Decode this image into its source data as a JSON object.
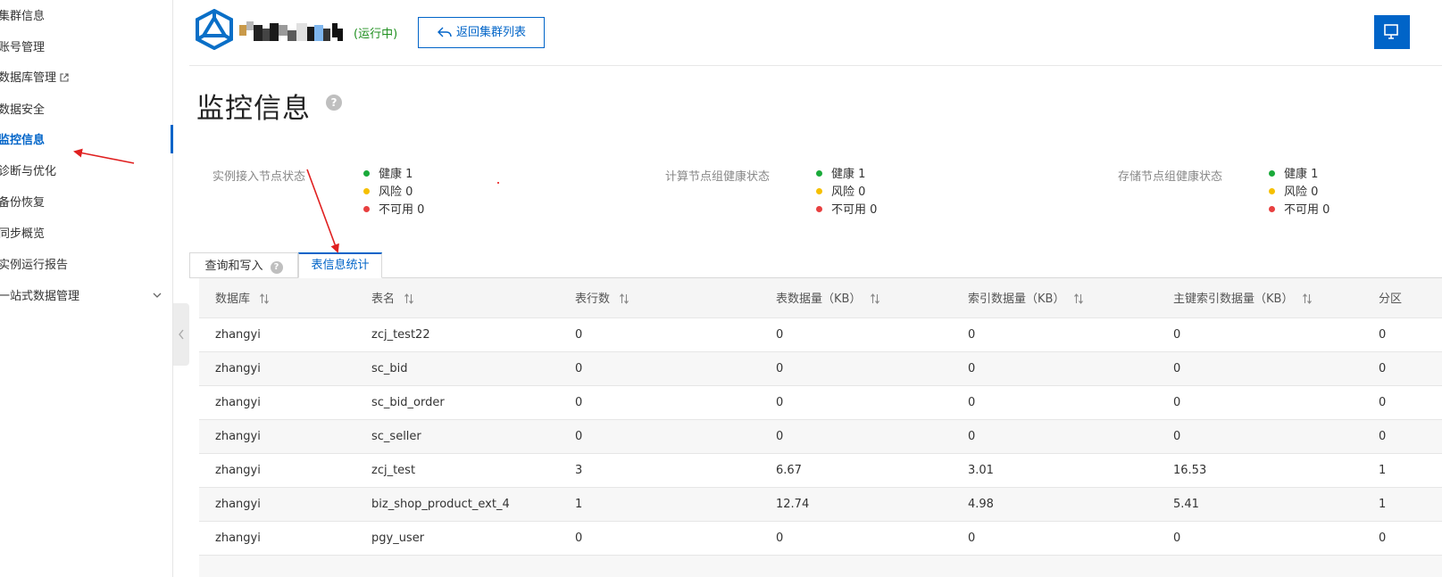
{
  "sidebar": {
    "items": [
      {
        "label": "集群信息"
      },
      {
        "label": "账号管理"
      },
      {
        "label": "数据库管理"
      },
      {
        "label": "数据安全"
      },
      {
        "label": "监控信息"
      },
      {
        "label": "诊断与优化"
      },
      {
        "label": "备份恢复"
      },
      {
        "label": "同步概览"
      },
      {
        "label": "实例运行报告"
      },
      {
        "label": "一站式数据管理"
      }
    ],
    "active_index": 4
  },
  "header": {
    "status": "(运行中)",
    "back_label": "返回集群列表"
  },
  "page": {
    "title": "监控信息",
    "help": "?"
  },
  "status_groups": [
    {
      "label": "实例接入节点状态",
      "items": [
        {
          "text": "健康 1",
          "color": "green"
        },
        {
          "text": "风险 0",
          "color": "yellow"
        },
        {
          "text": "不可用 0",
          "color": "red"
        }
      ]
    },
    {
      "label": "计算节点组健康状态",
      "items": [
        {
          "text": "健康 1",
          "color": "green"
        },
        {
          "text": "风险 0",
          "color": "yellow"
        },
        {
          "text": "不可用 0",
          "color": "red"
        }
      ]
    },
    {
      "label": "存储节点组健康状态",
      "items": [
        {
          "text": "健康 1",
          "color": "green"
        },
        {
          "text": "风险 0",
          "color": "yellow"
        },
        {
          "text": "不可用 0",
          "color": "red"
        }
      ]
    }
  ],
  "tabs": [
    {
      "label": "查询和写入",
      "help": "?"
    },
    {
      "label": "表信息统计"
    }
  ],
  "table": {
    "columns": [
      "数据库",
      "表名",
      "表行数",
      "表数据量（KB）",
      "索引数据量（KB）",
      "主键索引数据量（KB）",
      "分区"
    ],
    "rows": [
      [
        "zhangyi",
        "zcj_test22",
        "0",
        "0",
        "0",
        "0",
        "0"
      ],
      [
        "zhangyi",
        "sc_bid",
        "0",
        "0",
        "0",
        "0",
        "0"
      ],
      [
        "zhangyi",
        "sc_bid_order",
        "0",
        "0",
        "0",
        "0",
        "0"
      ],
      [
        "zhangyi",
        "sc_seller",
        "0",
        "0",
        "0",
        "0",
        "0"
      ],
      [
        "zhangyi",
        "zcj_test",
        "3",
        "6.67",
        "3.01",
        "16.53",
        "1"
      ],
      [
        "zhangyi",
        "biz_shop_product_ext_4",
        "1",
        "12.74",
        "4.98",
        "5.41",
        "1"
      ],
      [
        "zhangyi",
        "pgy_user",
        "0",
        "0",
        "0",
        "0",
        "0"
      ]
    ]
  },
  "colors": {
    "primary": "#0064c8",
    "running": "#1f8f1f",
    "healthy": "#1aaa3a",
    "risk": "#f6c000",
    "unavailable": "#e84040",
    "annotation_arrow": "#e02020"
  }
}
